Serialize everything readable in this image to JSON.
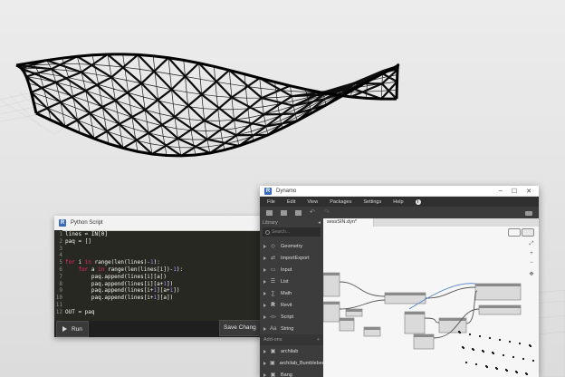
{
  "python_window": {
    "title": "Python Script",
    "code_lines": [
      {
        "n": "1",
        "html": "lines = IN[0]"
      },
      {
        "n": "2",
        "html": "paq = []"
      },
      {
        "n": "3",
        "html": ""
      },
      {
        "n": "4",
        "html": ""
      },
      {
        "n": "5",
        "html": "<span class='kw'>for</span> i <span class='kw'>in</span> range(len(lines)-<span class='nb'>1</span>):"
      },
      {
        "n": "6",
        "html": "    <span class='kw'>for</span> a <span class='kw'>in</span> range(len(lines[i])-<span class='nb'>1</span>):"
      },
      {
        "n": "7",
        "html": "        paq.append(lines[i][a])"
      },
      {
        "n": "8",
        "html": "        paq.append(lines[i][a+<span class='nb'>1</span>])"
      },
      {
        "n": "9",
        "html": "        paq.append(lines[i+<span class='nb'>1</span>][a+<span class='nb'>1</span>])"
      },
      {
        "n": "10",
        "html": "        paq.append(lines[i+<span class='nb'>1</span>][a])"
      },
      {
        "n": "11",
        "html": ""
      },
      {
        "n": "12",
        "html": "OUT = paq"
      }
    ],
    "run_label": "Run",
    "save_label": "Save Chang"
  },
  "dynamo_window": {
    "title": "Dynamo",
    "menu": [
      "File",
      "Edit",
      "View",
      "Packages",
      "Settings",
      "Help"
    ],
    "library_label": "Library",
    "search_placeholder": "Search...",
    "library_items": [
      {
        "label": "Geometry",
        "icon": "geometry-icon"
      },
      {
        "label": "ImportExport",
        "icon": "import-export-icon"
      },
      {
        "label": "Input",
        "icon": "input-icon"
      },
      {
        "label": "List",
        "icon": "list-icon"
      },
      {
        "label": "Math",
        "icon": "math-icon"
      },
      {
        "label": "Revit",
        "icon": "revit-icon"
      },
      {
        "label": "Script",
        "icon": "script-icon"
      },
      {
        "label": "String",
        "icon": "string-icon"
      }
    ],
    "addons_label": "Add-ons",
    "addon_items": [
      {
        "label": "archilab",
        "icon": "package-icon"
      },
      {
        "label": "archilab_Bumblebee",
        "icon": "package-icon"
      },
      {
        "label": "Bang",
        "icon": "package-icon"
      }
    ],
    "tab_title": "sessSIN.dyn*"
  }
}
